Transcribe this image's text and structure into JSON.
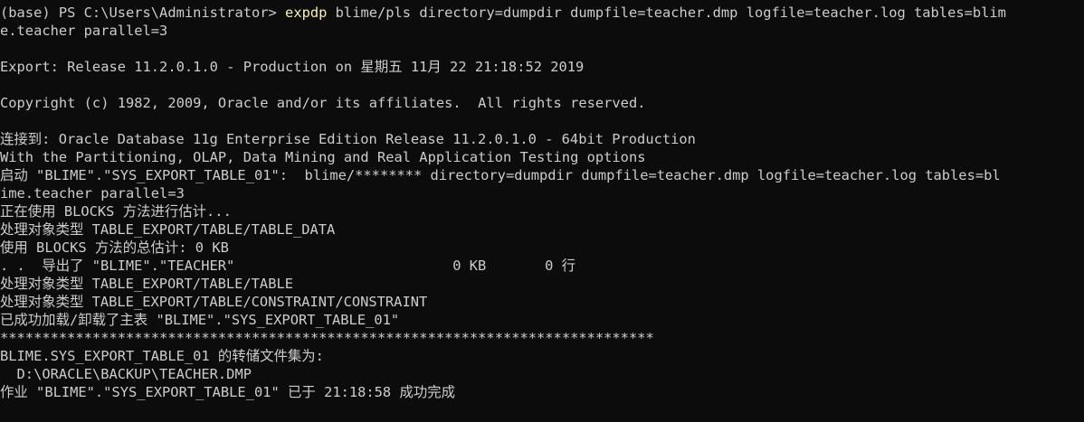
{
  "terminal": {
    "prompt": "(base) PS C:\\Users\\Administrator> ",
    "command": "expdp",
    "command_args_1": " blime/pls directory=dumpdir dumpfile=teacher.dmp logfile=teacher.log tables=blim",
    "command_args_2": "e.teacher parallel=3",
    "export_release": "Export: Release 11.2.0.1.0 - Production on 星期五 11月 22 21:18:52 2019",
    "copyright": "Copyright (c) 1982, 2009, Oracle and/or its affiliates.  All rights reserved.",
    "connected": "连接到: Oracle Database 11g Enterprise Edition Release 11.2.0.1.0 - 64bit Production",
    "options": "With the Partitioning, OLAP, Data Mining and Real Application Testing options",
    "start_1": "启动 \"BLIME\".\"SYS_EXPORT_TABLE_01\":  blime/******** directory=dumpdir dumpfile=teacher.dmp logfile=teacher.log tables=bl",
    "start_2": "ime.teacher parallel=3",
    "estimate": "正在使用 BLOCKS 方法进行估计...",
    "process_data": "处理对象类型 TABLE_EXPORT/TABLE/TABLE_DATA",
    "estimate_total": "使用 BLOCKS 方法的总估计: 0 KB",
    "exported": ". .  导出了 \"BLIME\".\"TEACHER\"                          0 KB       0 行",
    "process_table": "处理对象类型 TABLE_EXPORT/TABLE/TABLE",
    "process_constraint": "处理对象类型 TABLE_EXPORT/TABLE/CONSTRAINT/CONSTRAINT",
    "master_loaded": "已成功加载/卸载了主表 \"BLIME\".\"SYS_EXPORT_TABLE_01\"",
    "stars": "******************************************************************************",
    "dump_set": "BLIME.SYS_EXPORT_TABLE_01 的转储文件集为:",
    "dump_file": "  D:\\ORACLE\\BACKUP\\TEACHER.DMP",
    "job_done": "作业 \"BLIME\".\"SYS_EXPORT_TABLE_01\" 已于 21:18:58 成功完成"
  },
  "colors": {
    "background": "#0c0c0c",
    "text": "#cccccc",
    "command": "#f9f1a5"
  }
}
